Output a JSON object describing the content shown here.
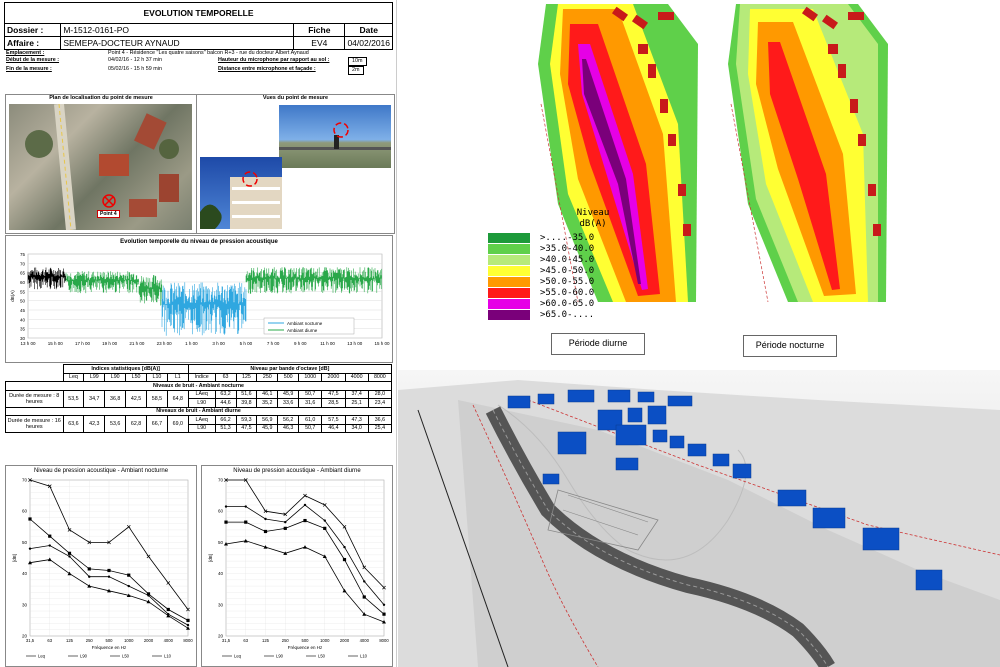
{
  "header": {
    "title": "EVOLUTION TEMPORELLE",
    "dossier_label": "Dossier :",
    "dossier_value": "M-1512-0161-PO",
    "affaire_label": "Affaire :",
    "affaire_value": "SEMEPA-DOCTEUR AYNAUD",
    "fiche_label": "Fiche",
    "fiche_value": "EV4",
    "date_label": "Date",
    "date_value": "04/02/2016"
  },
  "info": {
    "emplacement_label": "Emplacement :",
    "emplacement_value": "Point 4 - Résidence \"Les quatre saisons\" balcon R+3 - rue du docteur Albert Aynaud",
    "debut_label": "Début de la mesure :",
    "debut_value": "04/02/16 - 12 h 37 min",
    "fin_label": "Fin de la mesure :",
    "fin_value": "05/02/16 - 15 h 59 min",
    "hauteur_label": "Hauteur du microphone par rapport au sol :",
    "hauteur_value": "10m",
    "distance_label": "Distance entre microphone et façade :",
    "distance_value": "2m"
  },
  "photos": {
    "plan_title": "Plan de localisation du point de mesure",
    "vues_title": "Vues du point de mesure",
    "point_label": "Point 4"
  },
  "timechart": {
    "title": "Evolution temporelle du niveau de pression acoustique",
    "ylabel": "dB(A)",
    "yticks": [
      "75",
      "70",
      "65",
      "60",
      "55",
      "50",
      "45",
      "40",
      "35",
      "30"
    ],
    "xticks": [
      "13 h 00",
      "15 h 00",
      "17 h 00",
      "19 h 00",
      "21 h 00",
      "23 h 00",
      "1 h 00",
      "3 h 00",
      "5 h 00",
      "7 h 00",
      "9 h 00",
      "11 h 00",
      "13 h 00",
      "15 h 00"
    ],
    "legend": [
      "Ambiant nocturne",
      "Ambiant diurne"
    ]
  },
  "stats": {
    "indices_title": "Indices statistiques [dB(A)]",
    "octave_title": "Niveau par bande d'octave [dB]",
    "indice_cols": [
      "Leq",
      "L99",
      "L90",
      "L50",
      "L10",
      "L1"
    ],
    "octave_cols": [
      "Indice",
      "63",
      "125",
      "250",
      "500",
      "1000",
      "2000",
      "4000",
      "8000"
    ],
    "nocturne_title": "Niveaux de bruit - Ambiant nocturne",
    "nocturne_duree": "Durée de mesure : 8 heures",
    "nocturne_indices": [
      "53,5",
      "34,7",
      "36,8",
      "42,5",
      "58,5",
      "64,8"
    ],
    "nocturne_laeq_label": "LAeq",
    "nocturne_laeq": [
      "63,2",
      "51,6",
      "46,1",
      "45,9",
      "50,7",
      "47,5",
      "37,4",
      "28,0"
    ],
    "nocturne_l90_label": "L90",
    "nocturne_l90": [
      "44,6",
      "39,8",
      "35,2",
      "33,6",
      "31,6",
      "28,5",
      "25,1",
      "23,4"
    ],
    "diurne_title": "Niveaux de bruit - Ambiant diurne",
    "diurne_duree": "Durée de mesure : 16 heures",
    "diurne_indices": [
      "63,6",
      "42,3",
      "53,6",
      "62,8",
      "66,7",
      "69,0"
    ],
    "diurne_laeq_label": "LAeq",
    "diurne_laeq": [
      "66,2",
      "59,3",
      "56,9",
      "56,2",
      "61,0",
      "57,5",
      "47,3",
      "36,6"
    ],
    "diurne_l90_label": "L90",
    "diurne_l90": [
      "51,3",
      "47,5",
      "45,9",
      "46,3",
      "50,7",
      "46,4",
      "34,0",
      "25,4"
    ]
  },
  "map": {
    "legend_title_1": "Niveau",
    "legend_title_2": "dB(A)",
    "legend_items": [
      {
        "label": ">....-35.0",
        "color": "#1d9a3a"
      },
      {
        "label": ">35.0-40.0",
        "color": "#5fd04a"
      },
      {
        "label": ">40.0-45.0",
        "color": "#b6ea7a"
      },
      {
        "label": ">45.0-50.0",
        "color": "#ffff33"
      },
      {
        "label": ">50.0-55.0",
        "color": "#ff9900"
      },
      {
        "label": ">55.0-60.0",
        "color": "#ff1a1a"
      },
      {
        "label": ">60.0-65.0",
        "color": "#e600e6"
      },
      {
        "label": ">65.0-....",
        "color": "#7a007a"
      }
    ],
    "caption_day": "Période diurne",
    "caption_night": "Période nocturne"
  },
  "chart_data": [
    {
      "type": "line",
      "title": "Niveau de pression acoustique - Ambiant nocturne",
      "xlabel": "Fréquence en Hz",
      "ylabel": "[dB]",
      "categories": [
        "31,5",
        "63",
        "125",
        "250",
        "500",
        "1000",
        "2000",
        "4000",
        "8000"
      ],
      "ylim": [
        20,
        70
      ],
      "yticks": [
        "70",
        "60",
        "50",
        "40",
        "30",
        "20"
      ],
      "legend_labels": [
        "Leq",
        "L90",
        "L50",
        "L10"
      ],
      "series": [
        {
          "name": "Leq",
          "values": [
            57.5,
            52,
            46.5,
            41.5,
            41,
            39.5,
            33.5,
            28.5,
            25
          ]
        },
        {
          "name": "L90",
          "values": [
            43.5,
            44.5,
            40,
            36,
            34.5,
            33,
            31,
            26.5,
            22.5
          ]
        },
        {
          "name": "L50",
          "values": [
            48,
            49,
            45.5,
            39,
            39,
            36,
            33,
            27,
            23.5
          ]
        },
        {
          "name": "L10",
          "values": [
            72,
            68,
            54,
            50,
            50,
            55,
            45.5,
            37,
            28.5
          ]
        }
      ]
    },
    {
      "type": "line",
      "title": "Niveau de pression acoustique - Ambiant diurne",
      "xlabel": "Fréquence en Hz",
      "ylabel": "[dB]",
      "categories": [
        "31,5",
        "63",
        "125",
        "250",
        "500",
        "1000",
        "2000",
        "4000",
        "8000"
      ],
      "ylim": [
        20,
        70
      ],
      "yticks": [
        "70",
        "60",
        "50",
        "40",
        "30",
        "20"
      ],
      "legend_labels": [
        "Leq",
        "L90",
        "L50",
        "L10"
      ],
      "series": [
        {
          "name": "Leq",
          "values": [
            56.5,
            56.5,
            53.5,
            54.5,
            57,
            54.5,
            44.5,
            32.5,
            27
          ]
        },
        {
          "name": "L90",
          "values": [
            49.5,
            50.5,
            48.5,
            46.5,
            48.5,
            45.5,
            34.5,
            27,
            24.5
          ]
        },
        {
          "name": "L50",
          "values": [
            61.5,
            61.5,
            57.5,
            56.5,
            62,
            57,
            48.5,
            37.5,
            30
          ]
        },
        {
          "name": "L10",
          "values": [
            72,
            72,
            60,
            59,
            65,
            62,
            55,
            42,
            35.5
          ]
        }
      ]
    }
  ]
}
